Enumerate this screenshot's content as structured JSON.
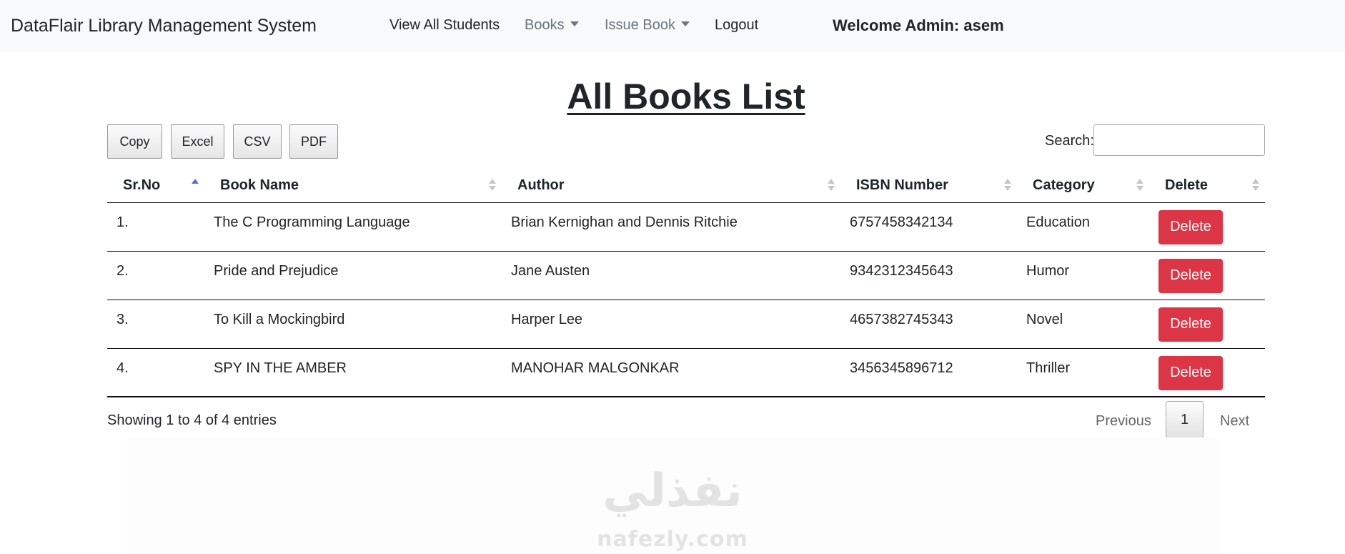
{
  "nav": {
    "brand": "DataFlair Library Management System",
    "items": [
      {
        "label": "View All Students"
      },
      {
        "label": "Books"
      },
      {
        "label": "Issue Book"
      },
      {
        "label": "Logout"
      }
    ],
    "welcome": "Welcome Admin: asem"
  },
  "page": {
    "title": "All Books List"
  },
  "toolbar": {
    "copy": "Copy",
    "excel": "Excel",
    "csv": "CSV",
    "pdf": "PDF",
    "search_label": "Search:",
    "search_value": ""
  },
  "table": {
    "columns": [
      "Sr.No",
      "Book Name",
      "Author",
      "ISBN Number",
      "Category",
      "Delete"
    ],
    "rows": [
      {
        "sr": "1.",
        "name": "The C Programming Language",
        "author": "Brian Kernighan and Dennis Ritchie",
        "isbn": "6757458342134",
        "category": "Education",
        "action": "Delete"
      },
      {
        "sr": "2.",
        "name": "Pride and Prejudice",
        "author": "Jane Austen",
        "isbn": "9342312345643",
        "category": "Humor",
        "action": "Delete"
      },
      {
        "sr": "3.",
        "name": "To Kill a Mockingbird",
        "author": "Harper Lee",
        "isbn": "4657382745343",
        "category": "Novel",
        "action": "Delete"
      },
      {
        "sr": "4.",
        "name": "SPY IN THE AMBER",
        "author": "MANOHAR MALGONKAR",
        "isbn": "3456345896712",
        "category": "Thriller",
        "action": "Delete"
      }
    ]
  },
  "footer": {
    "info": "Showing 1 to 4 of 4 entries",
    "previous": "Previous",
    "current_page": "1",
    "next": "Next"
  },
  "watermark": {
    "arabic": "نفذلي",
    "latin": "nafezly.com"
  },
  "colors": {
    "navbar_bg": "#f8f9fa",
    "delete_button": "#dc3545",
    "sort_active": "#5a6ad5",
    "muted_text": "#6c757d"
  }
}
